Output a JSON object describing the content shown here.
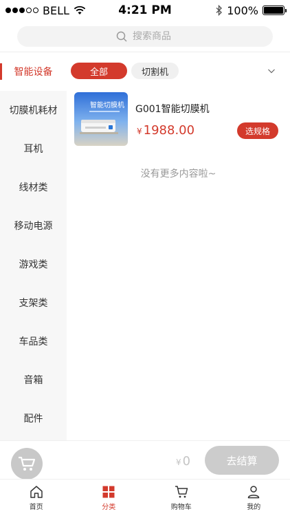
{
  "status_bar": {
    "carrier": "BELL",
    "time": "4:21 PM",
    "battery": "100%",
    "battery_level": 1.0
  },
  "search": {
    "placeholder": "搜索商品"
  },
  "sidebar": {
    "items": [
      {
        "label": "智能设备",
        "active": true
      },
      {
        "label": "切膜机耗材",
        "active": false
      },
      {
        "label": "耳机",
        "active": false
      },
      {
        "label": "线材类",
        "active": false
      },
      {
        "label": "移动电源",
        "active": false
      },
      {
        "label": "游戏类",
        "active": false
      },
      {
        "label": "支架类",
        "active": false
      },
      {
        "label": "车品类",
        "active": false
      },
      {
        "label": "音箱",
        "active": false
      },
      {
        "label": "配件",
        "active": false
      }
    ]
  },
  "filters": {
    "chips": [
      {
        "label": "全部",
        "active": true
      },
      {
        "label": "切割机",
        "active": false
      }
    ]
  },
  "product": {
    "name": "G001智能切膜机",
    "image_text": "智能切膜机",
    "currency": "¥",
    "price": "1988.00",
    "spec_button": "选规格"
  },
  "no_more": "没有更多内容啦~",
  "cart": {
    "currency": "¥",
    "total": "0",
    "checkout_label": "去结算"
  },
  "tab_bar": {
    "items": [
      {
        "label": "首页",
        "icon": "home-icon",
        "active": false
      },
      {
        "label": "分类",
        "icon": "category-icon",
        "active": true
      },
      {
        "label": "购物车",
        "icon": "cart-icon",
        "active": false
      },
      {
        "label": "我的",
        "icon": "profile-icon",
        "active": false
      }
    ]
  },
  "colors": {
    "accent": "#d33a2c",
    "sidebar_bg": "#f7f7f7",
    "disabled": "#cccccc"
  }
}
